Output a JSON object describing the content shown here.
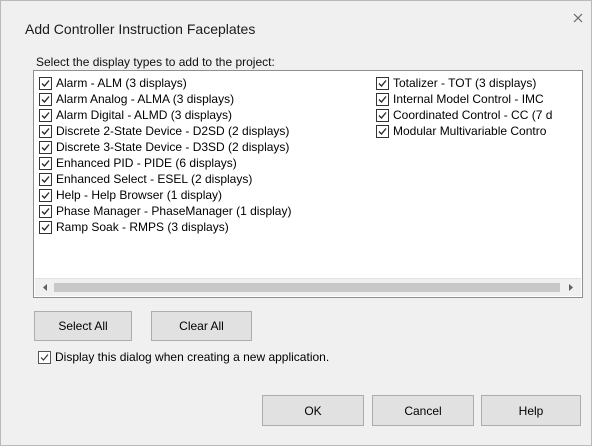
{
  "dialog": {
    "title": "Add Controller Instruction Faceplates",
    "prompt": "Select the display types to add to the project:"
  },
  "list": {
    "column1": [
      {
        "label": "Alarm - ALM (3 displays)",
        "checked": true
      },
      {
        "label": "Alarm Analog - ALMA (3 displays)",
        "checked": true
      },
      {
        "label": "Alarm Digital - ALMD (3 displays)",
        "checked": true
      },
      {
        "label": "Discrete 2-State Device - D2SD (2 displays)",
        "checked": true
      },
      {
        "label": "Discrete 3-State Device - D3SD (2 displays)",
        "checked": true
      },
      {
        "label": "Enhanced PID - PIDE (6 displays)",
        "checked": true
      },
      {
        "label": "Enhanced Select - ESEL (2 displays)",
        "checked": true
      },
      {
        "label": "Help - Help Browser (1 display)",
        "checked": true
      },
      {
        "label": "Phase Manager - PhaseManager (1 display)",
        "checked": true
      },
      {
        "label": "Ramp Soak - RMPS (3 displays)",
        "checked": true
      }
    ],
    "column2": [
      {
        "label": "Totalizer - TOT (3 displays)",
        "checked": true
      },
      {
        "label": "Internal Model Control - IMC",
        "checked": true
      },
      {
        "label": "Coordinated Control - CC (7 d",
        "checked": true
      },
      {
        "label": "Modular Multivariable Contro",
        "checked": true
      }
    ]
  },
  "buttons": {
    "select_all": "Select All",
    "clear_all": "Clear All",
    "ok": "OK",
    "cancel": "Cancel",
    "help": "Help"
  },
  "show_dialog": {
    "label": "Display this dialog when creating a new application.",
    "checked": true
  },
  "icons": {
    "close": "close-icon",
    "checkbox": "check-icon",
    "scroll_left": "scroll-left-arrow-icon",
    "scroll_right": "scroll-right-arrow-icon"
  },
  "colors": {
    "dialog_bg": "#f0f0f0",
    "button_bg": "#e1e1e1",
    "button_border": "#adadad",
    "list_bg": "#ffffff"
  }
}
